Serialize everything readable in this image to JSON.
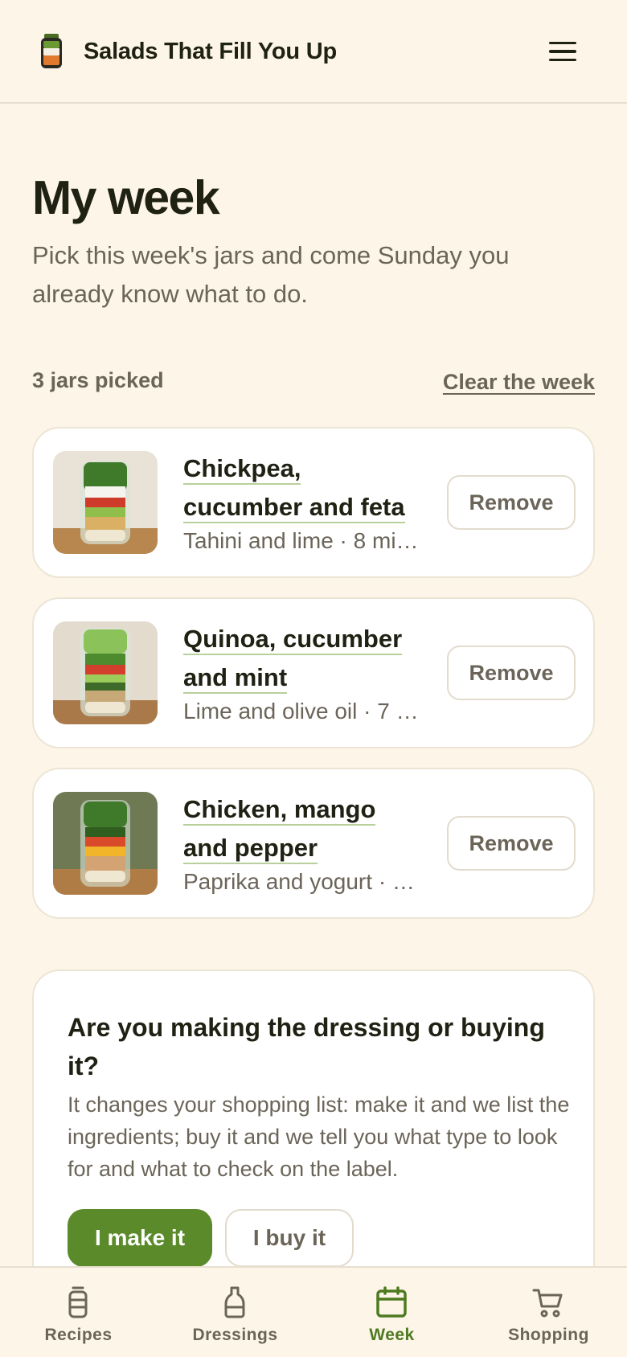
{
  "header": {
    "app_title": "Salads That Fill You Up",
    "logo_icon": "jar-logo-icon",
    "menu_icon": "hamburger-menu-icon"
  },
  "page": {
    "title": "My week",
    "subtitle": "Pick this week's jars and come Sunday you already know what to do.",
    "count_text": "3 jars picked",
    "clear_label": "Clear the week"
  },
  "jars": [
    {
      "name": "Chickpea, cucumber and feta",
      "meta": "Tahini and lime · 8 mi…",
      "remove_label": "Remove"
    },
    {
      "name": "Quinoa, cucumber and mint",
      "meta": "Lime and olive oil · 7 …",
      "remove_label": "Remove"
    },
    {
      "name": "Chicken, mango and pepper",
      "meta": "Paprika and yogurt · …",
      "remove_label": "Remove"
    }
  ],
  "dressing": {
    "title": "Are you making the dressing or buying it?",
    "text": "It changes your shopping list: make it and we list the ingredients; buy it and we tell you what type to look for and what to check on the label.",
    "make_label": "I make it",
    "buy_label": "I buy it",
    "selected": "make"
  },
  "tabbar": {
    "active": "Week",
    "tabs": [
      {
        "label": "Recipes",
        "icon": "jar-icon"
      },
      {
        "label": "Dressings",
        "icon": "bottle-icon"
      },
      {
        "label": "Week",
        "icon": "calendar-icon"
      },
      {
        "label": "Shopping",
        "icon": "cart-icon"
      }
    ]
  },
  "colors": {
    "background": "#fdf6e8",
    "accent": "#5b8a2b",
    "text": "#1f2113",
    "muted": "#6b6559"
  }
}
